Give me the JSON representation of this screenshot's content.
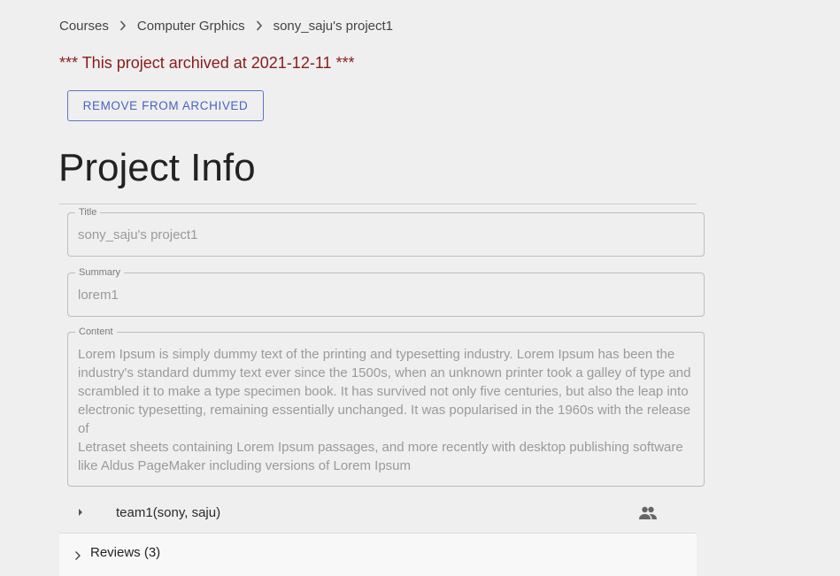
{
  "breadcrumb": {
    "items": [
      "Courses",
      "Computer Grphics",
      "sony_saju's project1"
    ]
  },
  "archived_notice": "*** This project archived at 2021-12-11 ***",
  "remove_button_label": "REMOVE FROM ARCHIVED",
  "page_title": "Project Info",
  "fields": {
    "title": {
      "label": "Title",
      "value": "sony_saju's project1"
    },
    "summary": {
      "label": "Summary",
      "value": "lorem1"
    },
    "content": {
      "label": "Content",
      "lines": [
        "Lorem Ipsum is simply dummy text of the printing and typesetting industry. Lorem Ipsum has been the",
        "industry's standard dummy text ever since the 1500s, when an unknown printer took a galley of type and",
        "scrambled it to make a type specimen book. It has survived not only five centuries, but also the leap into",
        "electronic typesetting, remaining essentially unchanged. It was popularised in the 1960s with the release of",
        "Letraset sheets containing Lorem Ipsum passages, and more recently with desktop publishing software",
        "like Aldus PageMaker including versions of Lorem Ipsum"
      ]
    }
  },
  "team": {
    "name": "team1(sony, saju)",
    "icon": "group-icon"
  },
  "reviews": {
    "label": "Reviews (3)"
  },
  "colors": {
    "background": "#efefef",
    "archived_text": "#8b1a1a",
    "button_accent": "#4663c4"
  }
}
